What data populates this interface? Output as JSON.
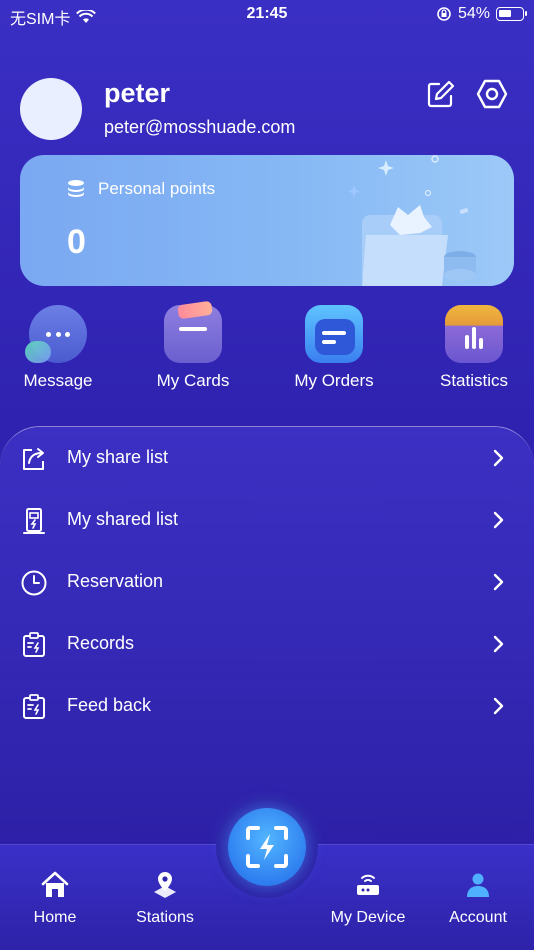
{
  "status_bar": {
    "carrier": "无SIM卡",
    "time": "21:45",
    "battery": "54%"
  },
  "profile": {
    "name": "peter",
    "email": "peter@mosshuade.com"
  },
  "points_card": {
    "label": "Personal points",
    "value": "0"
  },
  "quick_actions": [
    {
      "label": "Message",
      "icon": "message-icon"
    },
    {
      "label": "My Cards",
      "icon": "cards-icon"
    },
    {
      "label": "My Orders",
      "icon": "orders-icon"
    },
    {
      "label": "Statistics",
      "icon": "statistics-icon"
    }
  ],
  "menu": [
    {
      "label": "My share list",
      "icon": "share-icon"
    },
    {
      "label": "My shared list",
      "icon": "charger-icon"
    },
    {
      "label": "Reservation",
      "icon": "clock-icon"
    },
    {
      "label": "Records",
      "icon": "records-icon"
    },
    {
      "label": "Feed back",
      "icon": "feedback-icon"
    }
  ],
  "tabbar": [
    {
      "label": "Home",
      "icon": "home-icon"
    },
    {
      "label": "Stations",
      "icon": "map-pin-icon"
    },
    {
      "label": "My Device",
      "icon": "device-icon"
    },
    {
      "label": "Account",
      "icon": "user-icon",
      "active": true
    }
  ],
  "colors": {
    "accent": "#3a8ff5",
    "background": "#3127b4",
    "active_tab": "#4fb0ff"
  }
}
